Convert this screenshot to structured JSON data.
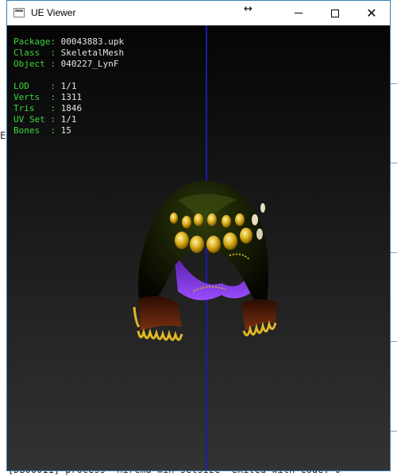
{
  "background": {
    "left_fragment": "E",
    "bottom_text": "[DB00011] process 'nircmd win setsize' exited with code: 0"
  },
  "window": {
    "title": "UE Viewer",
    "icons": {
      "app": "app-window-icon",
      "move": "move-cursor-icon",
      "minimize": "minimize-icon",
      "maximize": "maximize-icon",
      "close": "close-icon"
    }
  },
  "info": {
    "package": {
      "key": "Package:",
      "value": "00043883.upk"
    },
    "class": {
      "key": "Class  :",
      "value": "SkeletalMesh"
    },
    "object": {
      "key": "Object :",
      "value": "040227_LynF"
    },
    "lod": {
      "key": "LOD    :",
      "value": "1/1"
    },
    "verts": {
      "key": "Verts  :",
      "value": "1311"
    },
    "tris": {
      "key": "Tris   :",
      "value": "1846"
    },
    "uvset": {
      "key": "UV Set :",
      "value": "1/1"
    },
    "bones": {
      "key": "Bones  :",
      "value": "15"
    }
  },
  "colors": {
    "label_green": "#3ed63e",
    "value_white": "#e6e6e6",
    "axis_blue": "#1a1ab0",
    "window_border": "#3c7fb1"
  }
}
